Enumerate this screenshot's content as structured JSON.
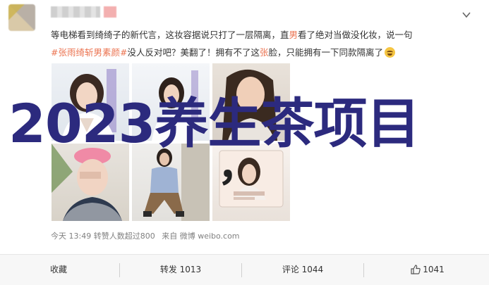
{
  "post": {
    "text_line1": "等电梯看到绮绮子的新代言，这妆容据说只打了一层隔离，直男看了绝对当做没化妆，说一句",
    "line1_a": "等电梯看到绮绮子的新代言，这妆容据说只打了一层隔离，直",
    "line1_hl": "男",
    "line1_b": "看了绝对当做没化妆，说一句",
    "hashtag": "#张雨绮斩男素颜#",
    "line2_a": "没人反对吧？美翻了！拥有不了这",
    "line2_hl": "张",
    "line2_b": "脸，只能拥有一下同款隔离了"
  },
  "overlay": {
    "headline": "2023养生茶项目",
    "comma": "，"
  },
  "meta": {
    "time": "今天 13:49",
    "reposts": "转赞人数超过800",
    "source": "来自 微博 weibo.com"
  },
  "actions": {
    "collect": "收藏",
    "repost": "转发 1013",
    "comment": "评论 1044",
    "like": "1041"
  },
  "icons": [
    "chevron-down-icon",
    "laugh-emoji-icon",
    "thumbs-up-icon"
  ],
  "colors": {
    "accent": "#eb7350",
    "overlay_text": "#2c2a7e",
    "action_bar": "#f7f7f7"
  }
}
